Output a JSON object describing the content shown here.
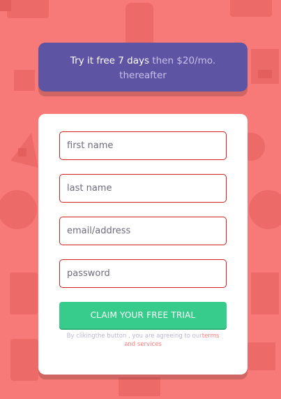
{
  "promo": {
    "highlight": "Try it free 7 days",
    "rest": " then $20/mo. thereafter"
  },
  "form": {
    "first_name_placeholder": "first name",
    "last_name_placeholder": "last name",
    "email_placeholder": "email/address",
    "password_placeholder": "password",
    "cta_label": "CLAIM YOUR FREE TRIAL",
    "terms_prefix": "By clikingthe button , you are agreeing to our",
    "terms_link": "terms and services"
  },
  "colors": {
    "background": "#f87a78",
    "promo": "#5e54a4",
    "cta": "#38cc8c",
    "field_border": "#d21f1f",
    "link": "#ff7a7a"
  }
}
